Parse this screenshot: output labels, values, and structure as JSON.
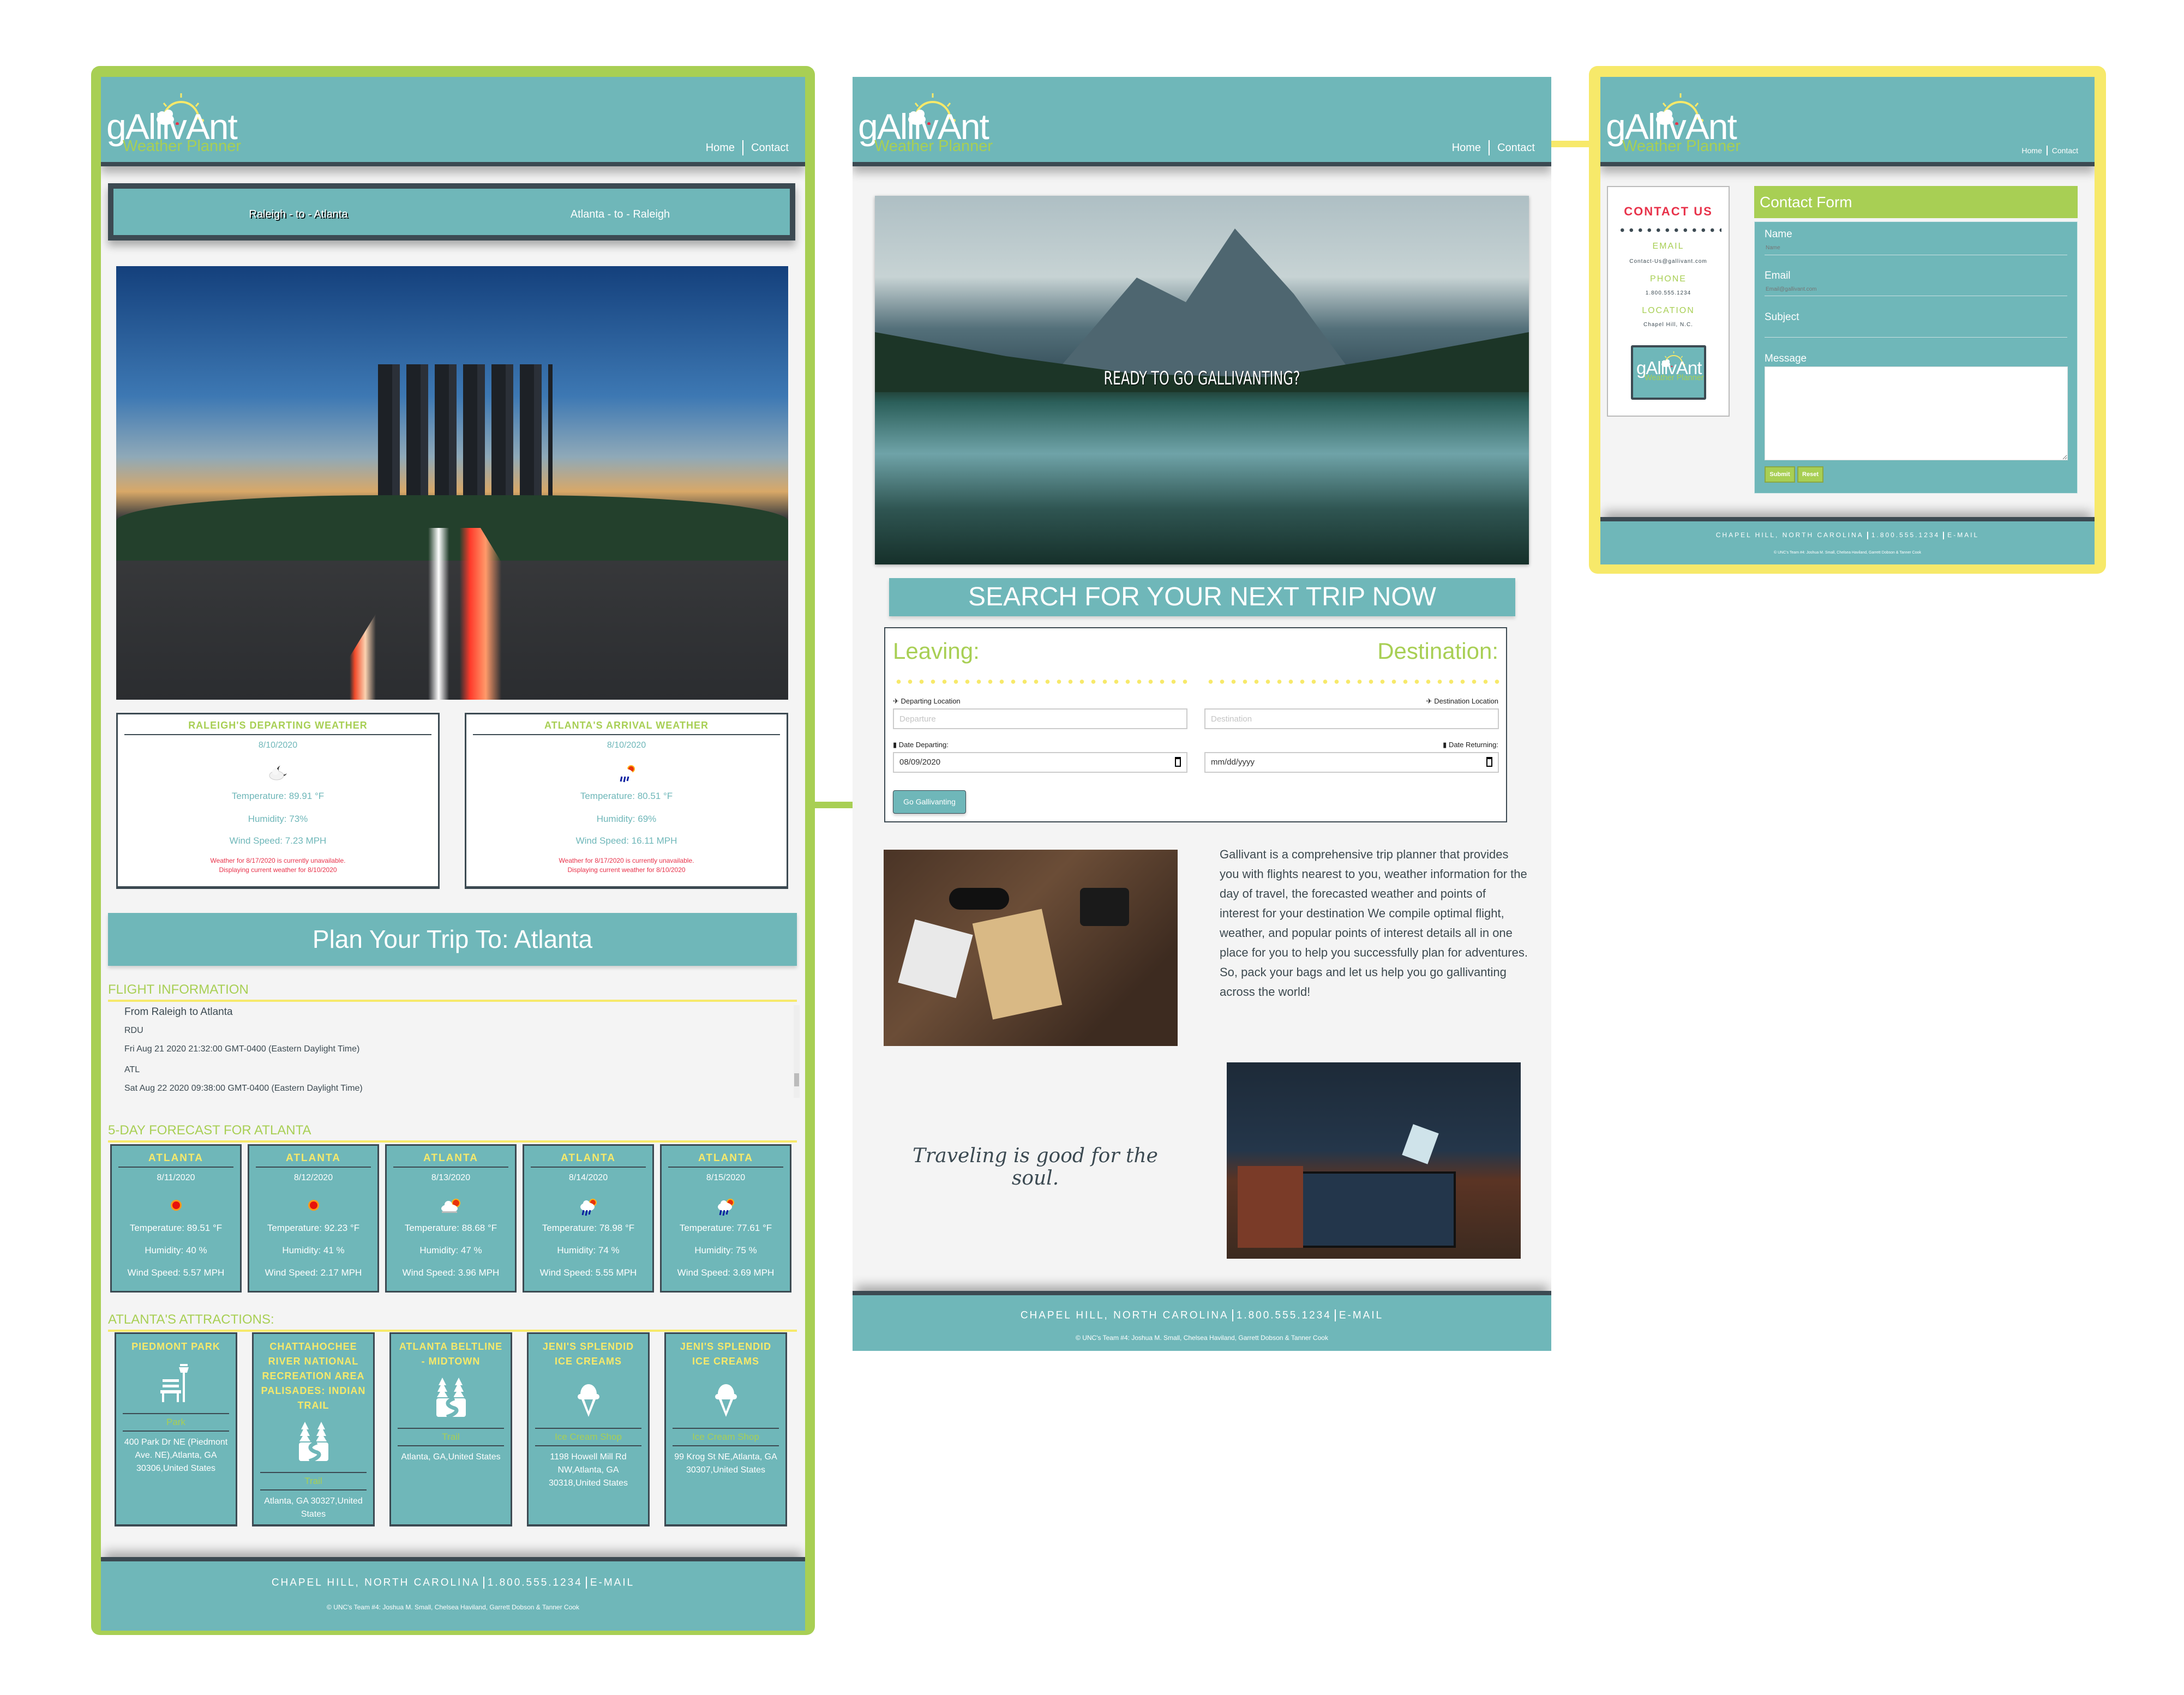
{
  "colors": {
    "teal": "#6fb7b9",
    "dark": "#3c4a52",
    "green": "#a8cf54",
    "yellow": "#f7e96a",
    "red": "#e8324a",
    "background": "#f4f4f4"
  },
  "logo": {
    "text": "gAllivAnt",
    "tagline": "Weather Planner"
  },
  "nav": {
    "home": "Home",
    "contact": "Contact"
  },
  "footer": {
    "city": "CHAPEL HILL, NORTH CAROLINA",
    "phone": "1.800.555.1234",
    "email": "E-MAIL",
    "copyright": "© UNC's Team #4: Joshua M. Small, Chelsea Haviland, Garrett Dobson & Tanner Cook"
  },
  "trip_page": {
    "route_tabs": [
      "Raleigh - to - Atlanta",
      "Atlanta - to - Raleigh"
    ],
    "weather_cards": [
      {
        "title": "RALEIGH'S DEPARTING WEATHER",
        "date": "8/10/2020",
        "icon": "cloudy-night-icon",
        "temperature": "Temperature: 89.91 °F",
        "humidity": "Humidity: 73%",
        "wind": "Wind Speed: 7.23 MPH",
        "notice": "Weather for 8/17/2020 is currently unavailable.",
        "notice2": "Displaying current weather for 8/10/2020"
      },
      {
        "title": "ATLANTA'S ARRIVAL WEATHER",
        "date": "8/10/2020",
        "icon": "rain-sun-icon",
        "temperature": "Temperature: 80.51 °F",
        "humidity": "Humidity: 69%",
        "wind": "Wind Speed: 16.11 MPH",
        "notice": "Weather for 8/17/2020 is currently unavailable.",
        "notice2": "Displaying current weather for 8/10/2020"
      }
    ],
    "plan_title": "Plan Your Trip To: Atlanta",
    "flight": {
      "heading": "FLIGHT INFORMATION",
      "lines": [
        "From Raleigh to Atlanta",
        "RDU",
        "Fri Aug 21 2020 21:32:00 GMT-0400 (Eastern Daylight Time)",
        "ATL",
        "Sat Aug 22 2020 09:38:00 GMT-0400 (Eastern Daylight Time)"
      ]
    },
    "forecast": {
      "heading": "5-DAY FORECAST FOR ATLANTA",
      "days": [
        {
          "city": "ATLANTA",
          "date": "8/11/2020",
          "icon": "sun-icon",
          "temperature": "Temperature: 89.51 °F",
          "humidity": "Humidity: 40 %",
          "wind": "Wind Speed: 5.57 MPH"
        },
        {
          "city": "ATLANTA",
          "date": "8/12/2020",
          "icon": "sun-icon",
          "temperature": "Temperature: 92.23 °F",
          "humidity": "Humidity: 41 %",
          "wind": "Wind Speed: 2.17 MPH"
        },
        {
          "city": "ATLANTA",
          "date": "8/13/2020",
          "icon": "cloud-sun-icon",
          "temperature": "Temperature: 88.68 °F",
          "humidity": "Humidity: 47 %",
          "wind": "Wind Speed: 3.96 MPH"
        },
        {
          "city": "ATLANTA",
          "date": "8/14/2020",
          "icon": "rain-sun-icon",
          "temperature": "Temperature: 78.98 °F",
          "humidity": "Humidity: 74 %",
          "wind": "Wind Speed: 5.55 MPH"
        },
        {
          "city": "ATLANTA",
          "date": "8/15/2020",
          "icon": "rain-sun-icon",
          "temperature": "Temperature: 77.61 °F",
          "humidity": "Humidity: 75 %",
          "wind": "Wind Speed: 3.69 MPH"
        }
      ]
    },
    "attractions": {
      "heading": "ATLANTA'S ATTRACTIONS:",
      "items": [
        {
          "name": "PIEDMONT PARK",
          "icon": "park-bench-icon",
          "type": "Park",
          "address": "400 Park Dr NE (Piedmont Ave. NE),Atlanta, GA 30306,United States"
        },
        {
          "name": "CHATTAHOCHEE RIVER NATIONAL RECREATION AREA PALISADES: INDIAN TRAIL",
          "icon": "trail-icon",
          "type": "Trail",
          "address": "Atlanta, GA 30327,United States"
        },
        {
          "name": "ATLANTA BELTLINE - MIDTOWN",
          "icon": "trail-icon",
          "type": "Trail",
          "address": "Atlanta, GA,United States"
        },
        {
          "name": "JENI'S SPLENDID ICE CREAMS",
          "icon": "ice-cream-icon",
          "type": "Ice Cream Shop",
          "address": "1198 Howell Mill Rd NW,Atlanta, GA 30318,United States"
        },
        {
          "name": "JENI'S SPLENDID ICE CREAMS",
          "icon": "ice-cream-icon",
          "type": "Ice Cream Shop",
          "address": "99 Krog St NE,Atlanta, GA 30307,United States"
        }
      ]
    }
  },
  "home_page": {
    "hero_text": "READY TO GO GALLIVANTING?",
    "search_title": "SEARCH FOR YOUR NEXT TRIP NOW",
    "leaving_label": "Leaving:",
    "destination_label": "Destination:",
    "departing_location_label": "Departing Location",
    "destination_location_label": "Destination Location",
    "departure_placeholder": "Departure",
    "destination_placeholder": "Destination",
    "date_departing_label": "Date Departing:",
    "date_returning_label": "Date Returning:",
    "date_departing_value": "08/09/2020",
    "date_returning_placeholder": "mm/dd/yyyy",
    "go_button": "Go Gallivanting",
    "about": "Gallivant is a comprehensive trip planner that provides you with flights nearest to you, weather information for the day of travel, the forecasted weather and points of interest for your destination We compile optimal flight, weather, and popular points of interest details all in one place for you to help you successfully plan for adventures. So, pack your bags and let us help you go gallivanting across the world!",
    "quote": "Traveling is good for the soul."
  },
  "contact_page": {
    "card_title": "CONTACT US",
    "email_label": "EMAIL",
    "email_value": "Contact-Us@gallivant.com",
    "phone_label": "PHONE",
    "phone_value": "1.800.555.1234",
    "location_label": "LOCATION",
    "location_value": "Chapel Hill, N.C.",
    "form_title": "Contact Form",
    "name_label": "Name",
    "name_placeholder": "Name",
    "email_field_label": "Email",
    "email_placeholder": "Email@gallivant.com",
    "subject_label": "Subject",
    "message_label": "Message",
    "submit": "Submit",
    "reset": "Reset"
  }
}
